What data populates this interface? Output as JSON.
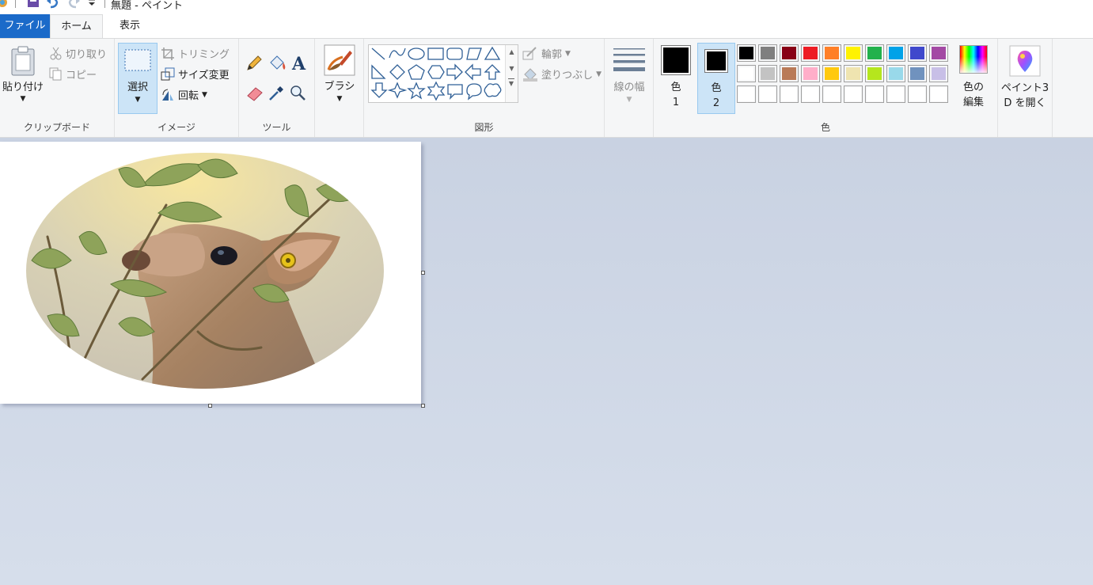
{
  "window": {
    "title": "無題 - ペイント"
  },
  "tabs": {
    "file": "ファイル",
    "home": "ホーム",
    "view": "表示"
  },
  "clipboard": {
    "group_label": "クリップボード",
    "paste": "貼り付け",
    "cut": "切り取り",
    "copy": "コピー"
  },
  "image": {
    "group_label": "イメージ",
    "select": "選択",
    "crop": "トリミング",
    "resize": "サイズ変更",
    "rotate": "回転"
  },
  "tools": {
    "group_label": "ツール",
    "items": [
      "pencil-icon",
      "fill-icon",
      "text-icon",
      "eraser-icon",
      "color-picker-icon",
      "magnifier-icon"
    ]
  },
  "brushes": {
    "label": "ブラシ"
  },
  "shapes": {
    "group_label": "図形",
    "outline": "輪郭",
    "fill": "塗りつぶし"
  },
  "size": {
    "label": "線の幅"
  },
  "colors": {
    "group_label": "色",
    "color1_line1": "色",
    "color1_line2": "1",
    "color2_line1": "色",
    "color2_line2": "2",
    "edit_line1": "色の",
    "edit_line2": "編集",
    "color1_value": "#000000",
    "color2_value": "#000000",
    "palette_row1": [
      "#000000",
      "#7f7f7f",
      "#880015",
      "#ed1c24",
      "#ff7f27",
      "#fff200",
      "#22b14c",
      "#00a2e8",
      "#3f48cc",
      "#a349a4"
    ],
    "palette_row2": [
      "#ffffff",
      "#c3c3c3",
      "#b97a57",
      "#ffaec9",
      "#ffc90e",
      "#efe4b0",
      "#b5e61d",
      "#99d9ea",
      "#7092be",
      "#c8bfe7"
    ],
    "palette_row3": [
      "#ffffff",
      "#ffffff",
      "#ffffff",
      "#ffffff",
      "#ffffff",
      "#ffffff",
      "#ffffff",
      "#ffffff",
      "#ffffff",
      "#ffffff"
    ]
  },
  "paint3d": {
    "line1": "ペイント3",
    "line2": "D を開く"
  },
  "canvas": {
    "image_subject": "mara eating leaves, oval crop"
  }
}
